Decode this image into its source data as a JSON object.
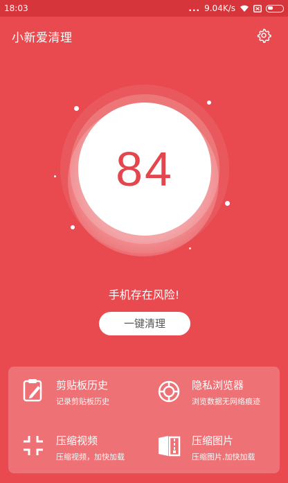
{
  "statusbar": {
    "time": "18:03",
    "dots": "...",
    "speed": "9.04K/s"
  },
  "header": {
    "title": "小新爱清理",
    "settings_icon": "gear-icon"
  },
  "score": {
    "value": "84"
  },
  "risk_message": "手机存在风险!",
  "clean_button": "一键清理",
  "features": [
    {
      "title": "剪贴板历史",
      "subtitle": "记录剪贴板历史",
      "icon": "clipboard-icon"
    },
    {
      "title": "隐私浏览器",
      "subtitle": "浏览数据无网络痕迹",
      "icon": "privacy-browser-icon"
    },
    {
      "title": "压缩视频",
      "subtitle": "压缩视频，加快加载",
      "icon": "compress-video-icon"
    },
    {
      "title": "压缩图片",
      "subtitle": "压缩图片,加快加载",
      "icon": "compress-image-icon"
    }
  ],
  "colors": {
    "background": "#e84a4f",
    "statusbar": "#d5353b",
    "score_text": "#e3464c"
  }
}
